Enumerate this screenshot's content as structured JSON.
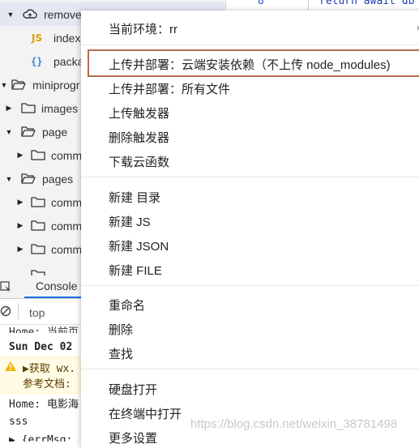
{
  "editor": {
    "line_number": "8",
    "code": "return await db"
  },
  "tree": {
    "items": [
      {
        "label": "remove",
        "type": "cloud",
        "caret": "down"
      },
      {
        "label": "index",
        "type": "js"
      },
      {
        "label": "packa",
        "type": "json"
      },
      {
        "label": "miniprogr",
        "type": "folder",
        "caret": "down"
      },
      {
        "label": "images",
        "type": "folder",
        "caret": "right"
      },
      {
        "label": "page",
        "type": "folder",
        "caret": "down"
      },
      {
        "label": "comm",
        "type": "folder",
        "caret": "right"
      },
      {
        "label": "pages",
        "type": "folder",
        "caret": "down"
      },
      {
        "label": "comm",
        "type": "folder",
        "caret": "right"
      },
      {
        "label": "comm",
        "type": "folder",
        "caret": "right"
      },
      {
        "label": "comm",
        "type": "folder",
        "caret": "right"
      }
    ],
    "js_badge": "JS",
    "json_badge": "{}"
  },
  "console": {
    "tab_label": "Console",
    "filter_value": "top",
    "lines": [
      "Home: 当前页",
      "Sun Dec 02",
      "▶获取 wx.",
      "参考文档:",
      "Home: 电影海",
      "sss",
      "▶ {errMsg:"
    ]
  },
  "menu": {
    "env_label": "当前环境：rr",
    "groups": [
      [
        "上传并部署：云端安装依赖（不上传 node_modules)",
        "上传并部署：所有文件",
        "上传触发器",
        "删除触发器",
        "下载云函数"
      ],
      [
        "新建 目录",
        "新建 JS",
        "新建 JSON",
        "新建 FILE"
      ],
      [
        "重命名",
        "删除",
        "查找"
      ],
      [
        "硬盘打开",
        "在终端中打开",
        "更多设置"
      ]
    ]
  },
  "watermark": "https://blog.csdn.net/weixin_38781498",
  "colors": {
    "highlight_border": "#b07050",
    "folder_stroke": "#333333",
    "js_badge": "#d9a100",
    "json_badge": "#1e88e5"
  }
}
